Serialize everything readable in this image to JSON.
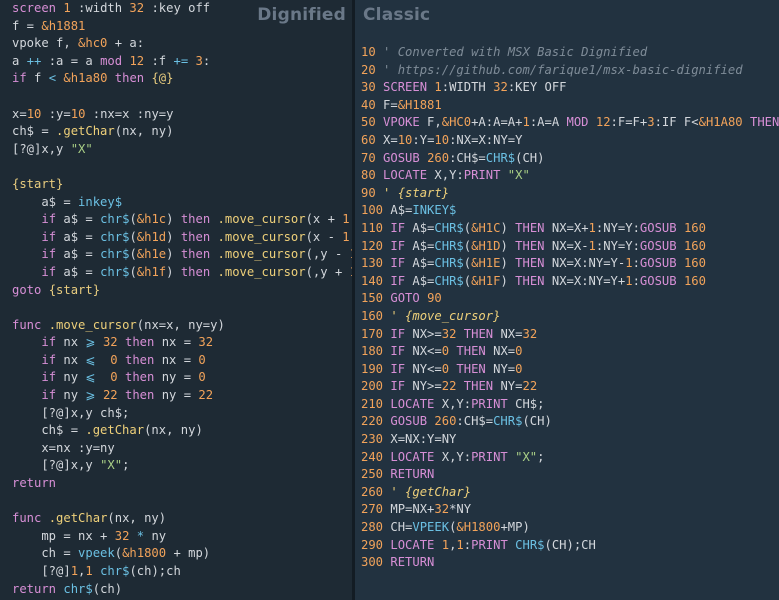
{
  "panes": {
    "left_title": "Dignified",
    "right_title": "Classic"
  },
  "colors": {
    "background": "#1e2a34",
    "keyword": "#d78fd6",
    "number": "#f2a35a",
    "string": "#a9cf86",
    "function": "#eed07a",
    "comment": "#7f8c98"
  },
  "dignified_code": [
    [
      [
        "screen ",
        "k"
      ],
      [
        "1",
        "n"
      ],
      " :width ",
      [
        "32",
        "n"
      ],
      " :key off"
    ],
    [
      "f = ",
      [
        "&h1881",
        "n"
      ]
    ],
    [
      "vpoke f, ",
      [
        "&hc0",
        "n"
      ],
      " + a:"
    ],
    [
      "a ",
      [
        "++",
        "p"
      ],
      " :a = a ",
      [
        "mod",
        "k"
      ],
      " ",
      [
        "12",
        "n"
      ],
      " :f ",
      [
        "+=",
        "p"
      ],
      " ",
      [
        "3",
        "n"
      ],
      ":"
    ],
    [
      [
        "if",
        "k"
      ],
      " f ",
      [
        "<",
        "p"
      ],
      " ",
      [
        "&h1a80",
        "n"
      ],
      " ",
      [
        "then",
        "k"
      ],
      " ",
      [
        "{@}",
        "g"
      ]
    ],
    [
      ""
    ],
    [
      "x=",
      [
        "10",
        "n"
      ],
      " :y=",
      [
        "10",
        "n"
      ],
      " :nx=x :ny=y"
    ],
    [
      "ch$ = ",
      [
        ".getChar",
        "f"
      ],
      "(nx, ny)"
    ],
    [
      "[?@]x,y ",
      [
        "\"X\"",
        "s"
      ]
    ],
    [
      ""
    ],
    [
      [
        "{start}",
        "g"
      ]
    ],
    [
      "    a$ = ",
      [
        "inkey$",
        "p"
      ]
    ],
    [
      "    ",
      [
        "if",
        "k"
      ],
      " a$ = ",
      [
        "chr$",
        "p"
      ],
      "(",
      [
        "&h1c",
        "n"
      ],
      ") ",
      [
        "then",
        "k"
      ],
      " ",
      [
        ".move_cursor",
        "f"
      ],
      "(x + ",
      [
        "1",
        "n"
      ],
      ",)"
    ],
    [
      "    ",
      [
        "if",
        "k"
      ],
      " a$ = ",
      [
        "chr$",
        "p"
      ],
      "(",
      [
        "&h1d",
        "n"
      ],
      ") ",
      [
        "then",
        "k"
      ],
      " ",
      [
        ".move_cursor",
        "f"
      ],
      "(x - ",
      [
        "1",
        "n"
      ],
      ",)"
    ],
    [
      "    ",
      [
        "if",
        "k"
      ],
      " a$ = ",
      [
        "chr$",
        "p"
      ],
      "(",
      [
        "&h1e",
        "n"
      ],
      ") ",
      [
        "then",
        "k"
      ],
      " ",
      [
        ".move_cursor",
        "f"
      ],
      "(,y - ",
      [
        "1",
        "n"
      ],
      ")"
    ],
    [
      "    ",
      [
        "if",
        "k"
      ],
      " a$ = ",
      [
        "chr$",
        "p"
      ],
      "(",
      [
        "&h1f",
        "n"
      ],
      ") ",
      [
        "then",
        "k"
      ],
      " ",
      [
        ".move_cursor",
        "f"
      ],
      "(,y + ",
      [
        "1",
        "n"
      ],
      ")"
    ],
    [
      [
        "goto",
        "k"
      ],
      " ",
      [
        "{start}",
        "g"
      ]
    ],
    [
      ""
    ],
    [
      [
        "func",
        "k"
      ],
      " ",
      [
        ".move_cursor",
        "f"
      ],
      "(nx=x, ny=y)"
    ],
    [
      "    ",
      [
        "if",
        "k"
      ],
      " nx ",
      [
        "⩾",
        "p"
      ],
      " ",
      [
        "32",
        "n"
      ],
      " ",
      [
        "then",
        "k"
      ],
      " nx = ",
      [
        "32",
        "n"
      ]
    ],
    [
      "    ",
      [
        "if",
        "k"
      ],
      " nx ",
      [
        "⩽",
        "p"
      ],
      " ",
      [
        " 0",
        "n"
      ],
      " ",
      [
        "then",
        "k"
      ],
      " nx = ",
      [
        "0",
        "n"
      ]
    ],
    [
      "    ",
      [
        "if",
        "k"
      ],
      " ny ",
      [
        "⩽",
        "p"
      ],
      " ",
      [
        " 0",
        "n"
      ],
      " ",
      [
        "then",
        "k"
      ],
      " ny = ",
      [
        "0",
        "n"
      ]
    ],
    [
      "    ",
      [
        "if",
        "k"
      ],
      " ny ",
      [
        "⩾",
        "p"
      ],
      " ",
      [
        "22",
        "n"
      ],
      " ",
      [
        "then",
        "k"
      ],
      " ny = ",
      [
        "22",
        "n"
      ]
    ],
    [
      "    [?@]x,y ch$;"
    ],
    [
      "    ch$ = ",
      [
        ".getChar",
        "f"
      ],
      "(nx, ny)"
    ],
    [
      "    x=nx :y=ny"
    ],
    [
      "    [?@]x,y ",
      [
        "\"X\"",
        "s"
      ],
      ";"
    ],
    [
      [
        "return",
        "k"
      ]
    ],
    [
      ""
    ],
    [
      [
        "func",
        "k"
      ],
      " ",
      [
        ".getChar",
        "f"
      ],
      "(nx, ny)"
    ],
    [
      "    mp = nx + ",
      [
        "32",
        "n"
      ],
      " ",
      [
        "*",
        "p"
      ],
      " ny"
    ],
    [
      "    ch = ",
      [
        "vpeek",
        "p"
      ],
      "(",
      [
        "&h1800",
        "n"
      ],
      " + mp)"
    ],
    [
      "    [?@]",
      [
        "1",
        "n"
      ],
      ",",
      [
        "1",
        "n"
      ],
      " ",
      [
        "chr$",
        "p"
      ],
      "(ch);ch"
    ],
    [
      [
        "return",
        "k"
      ],
      " ",
      [
        "chr$",
        "p"
      ],
      "(ch)"
    ]
  ],
  "classic_code": [
    [
      [
        "10",
        "n"
      ],
      " ",
      [
        "' Converted with MSX Basic Dignified",
        "c"
      ]
    ],
    [
      [
        "20",
        "n"
      ],
      " ",
      [
        "' https://github.com/farique1/msx-basic-dignified",
        "c"
      ]
    ],
    [
      [
        "30",
        "n"
      ],
      " ",
      [
        "SCREEN",
        "k"
      ],
      " ",
      [
        "1",
        "n"
      ],
      ":WIDTH ",
      [
        "32",
        "n"
      ],
      ":KEY OFF"
    ],
    [
      [
        "40",
        "n"
      ],
      " F=",
      [
        "&H1881",
        "n"
      ]
    ],
    [
      [
        "50",
        "n"
      ],
      " ",
      [
        "VPOKE",
        "k"
      ],
      " F,",
      [
        "&HC0",
        "n"
      ],
      "+A:A=A+",
      [
        "1",
        "n"
      ],
      ":A=A ",
      [
        "MOD",
        "k"
      ],
      " ",
      [
        "12",
        "n"
      ],
      ":F=F+",
      [
        "3",
        "n"
      ],
      ":IF F<",
      [
        "&H1A80",
        "n"
      ],
      " ",
      [
        "THEN",
        "k"
      ],
      " ",
      [
        "50",
        "n"
      ]
    ],
    [
      [
        "60",
        "n"
      ],
      " X=",
      [
        "10",
        "n"
      ],
      ":Y=",
      [
        "10",
        "n"
      ],
      ":NX=X:NY=Y"
    ],
    [
      [
        "70",
        "n"
      ],
      " ",
      [
        "GOSUB",
        "k"
      ],
      " ",
      [
        "260",
        "n"
      ],
      ":CH$=",
      [
        "CHR$",
        "p"
      ],
      "(CH)"
    ],
    [
      [
        "80",
        "n"
      ],
      " ",
      [
        "LOCATE",
        "k"
      ],
      " X,Y:",
      [
        "PRINT",
        "k"
      ],
      " ",
      [
        "\"X\"",
        "s"
      ]
    ],
    [
      [
        "90",
        "n"
      ],
      " ",
      [
        "' {start}",
        "l"
      ]
    ],
    [
      [
        "100",
        "n"
      ],
      " A$=",
      [
        "INKEY$",
        "p"
      ]
    ],
    [
      [
        "110",
        "n"
      ],
      " ",
      [
        "IF",
        "k"
      ],
      " A$=",
      [
        "CHR$",
        "p"
      ],
      "(",
      [
        "&H1C",
        "n"
      ],
      ") ",
      [
        "THEN",
        "k"
      ],
      " NX=X+",
      [
        "1",
        "n"
      ],
      ":NY=Y:",
      [
        "GOSUB",
        "k"
      ],
      " ",
      [
        "160",
        "n"
      ]
    ],
    [
      [
        "120",
        "n"
      ],
      " ",
      [
        "IF",
        "k"
      ],
      " A$=",
      [
        "CHR$",
        "p"
      ],
      "(",
      [
        "&H1D",
        "n"
      ],
      ") ",
      [
        "THEN",
        "k"
      ],
      " NX=X-",
      [
        "1",
        "n"
      ],
      ":NY=Y:",
      [
        "GOSUB",
        "k"
      ],
      " ",
      [
        "160",
        "n"
      ]
    ],
    [
      [
        "130",
        "n"
      ],
      " ",
      [
        "IF",
        "k"
      ],
      " A$=",
      [
        "CHR$",
        "p"
      ],
      "(",
      [
        "&H1E",
        "n"
      ],
      ") ",
      [
        "THEN",
        "k"
      ],
      " NX=X:NY=Y-",
      [
        "1",
        "n"
      ],
      ":",
      [
        "GOSUB",
        "k"
      ],
      " ",
      [
        "160",
        "n"
      ]
    ],
    [
      [
        "140",
        "n"
      ],
      " ",
      [
        "IF",
        "k"
      ],
      " A$=",
      [
        "CHR$",
        "p"
      ],
      "(",
      [
        "&H1F",
        "n"
      ],
      ") ",
      [
        "THEN",
        "k"
      ],
      " NX=X:NY=Y+",
      [
        "1",
        "n"
      ],
      ":",
      [
        "GOSUB",
        "k"
      ],
      " ",
      [
        "160",
        "n"
      ]
    ],
    [
      [
        "150",
        "n"
      ],
      " ",
      [
        "GOTO",
        "k"
      ],
      " ",
      [
        "90",
        "n"
      ]
    ],
    [
      [
        "160",
        "n"
      ],
      " ",
      [
        "' {move_cursor}",
        "l"
      ]
    ],
    [
      [
        "170",
        "n"
      ],
      " ",
      [
        "IF",
        "k"
      ],
      " NX>=",
      [
        "32",
        "n"
      ],
      " ",
      [
        "THEN",
        "k"
      ],
      " NX=",
      [
        "32",
        "n"
      ]
    ],
    [
      [
        "180",
        "n"
      ],
      " ",
      [
        "IF",
        "k"
      ],
      " NX<=",
      [
        "0",
        "n"
      ],
      " ",
      [
        "THEN",
        "k"
      ],
      " NX=",
      [
        "0",
        "n"
      ]
    ],
    [
      [
        "190",
        "n"
      ],
      " ",
      [
        "IF",
        "k"
      ],
      " NY<=",
      [
        "0",
        "n"
      ],
      " ",
      [
        "THEN",
        "k"
      ],
      " NY=",
      [
        "0",
        "n"
      ]
    ],
    [
      [
        "200",
        "n"
      ],
      " ",
      [
        "IF",
        "k"
      ],
      " NY>=",
      [
        "22",
        "n"
      ],
      " ",
      [
        "THEN",
        "k"
      ],
      " NY=",
      [
        "22",
        "n"
      ]
    ],
    [
      [
        "210",
        "n"
      ],
      " ",
      [
        "LOCATE",
        "k"
      ],
      " X,Y:",
      [
        "PRINT",
        "k"
      ],
      " CH$;"
    ],
    [
      [
        "220",
        "n"
      ],
      " ",
      [
        "GOSUB",
        "k"
      ],
      " ",
      [
        "260",
        "n"
      ],
      ":CH$=",
      [
        "CHR$",
        "p"
      ],
      "(CH)"
    ],
    [
      [
        "230",
        "n"
      ],
      " X=NX:Y=NY"
    ],
    [
      [
        "240",
        "n"
      ],
      " ",
      [
        "LOCATE",
        "k"
      ],
      " X,Y:",
      [
        "PRINT",
        "k"
      ],
      " ",
      [
        "\"X\"",
        "s"
      ],
      ";"
    ],
    [
      [
        "250",
        "n"
      ],
      " ",
      [
        "RETURN",
        "k"
      ]
    ],
    [
      [
        "260",
        "n"
      ],
      " ",
      [
        "' {getChar}",
        "l"
      ]
    ],
    [
      [
        "270",
        "n"
      ],
      " MP=NX+",
      [
        "32",
        "n"
      ],
      "*NY"
    ],
    [
      [
        "280",
        "n"
      ],
      " CH=",
      [
        "VPEEK",
        "p"
      ],
      "(",
      [
        "&H1800",
        "n"
      ],
      "+MP)"
    ],
    [
      [
        "290",
        "n"
      ],
      " ",
      [
        "LOCATE",
        "k"
      ],
      " ",
      [
        "1",
        "n"
      ],
      ",",
      [
        "1",
        "n"
      ],
      ":",
      [
        "PRINT",
        "k"
      ],
      " ",
      [
        "CHR$",
        "p"
      ],
      "(CH);CH"
    ],
    [
      [
        "300",
        "n"
      ],
      " ",
      [
        "RETURN",
        "k"
      ]
    ]
  ]
}
